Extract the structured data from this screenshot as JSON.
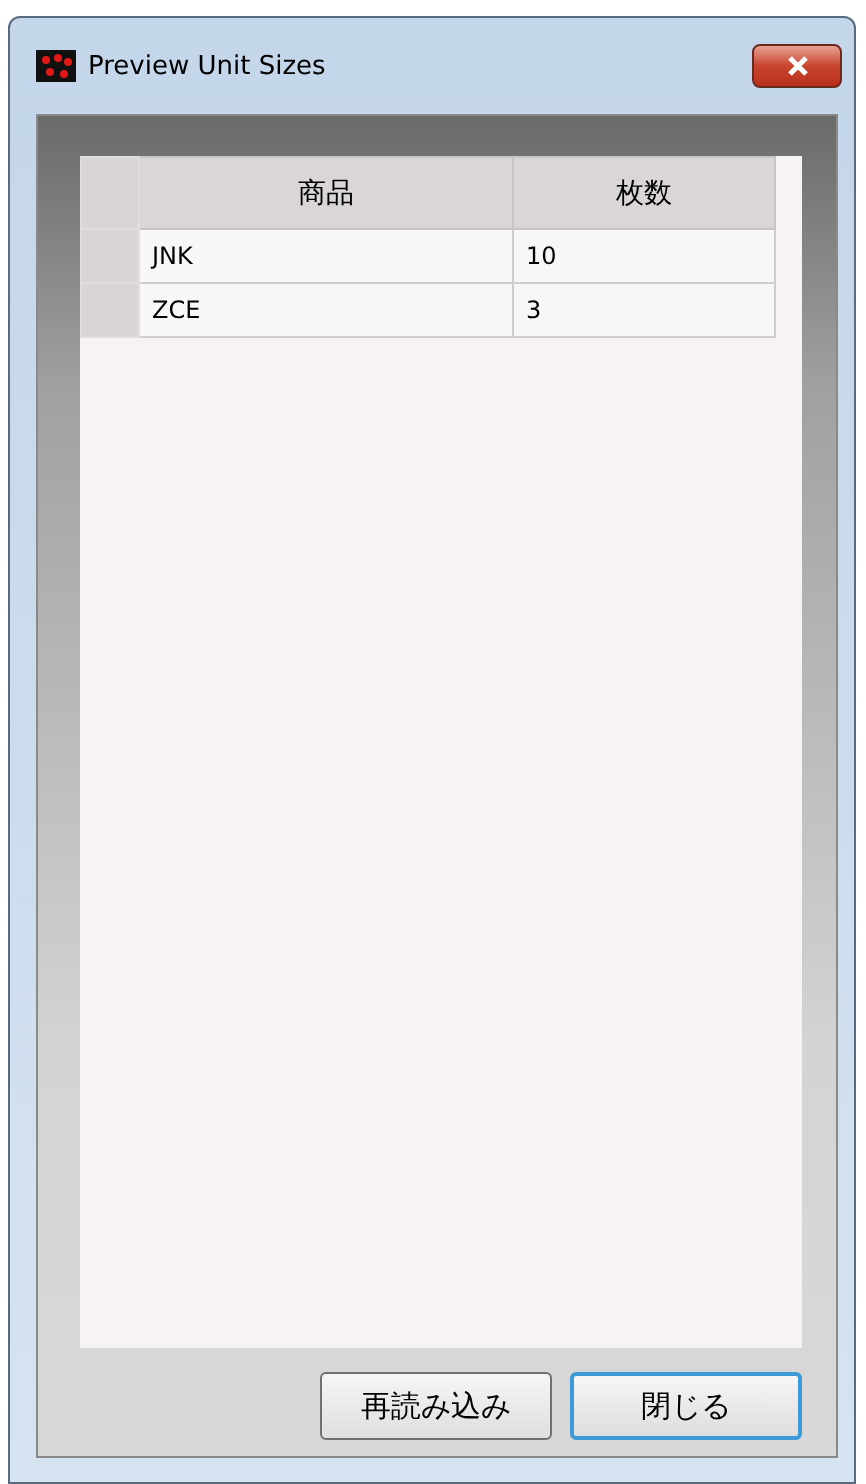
{
  "window": {
    "title": "Preview Unit Sizes"
  },
  "table": {
    "columns": [
      "商品",
      "枚数"
    ],
    "rows": [
      {
        "cells": [
          "JNK",
          "10"
        ]
      },
      {
        "cells": [
          "ZCE",
          "3"
        ]
      }
    ]
  },
  "buttons": [
    {
      "label": "再読み込み",
      "selected": false
    },
    {
      "label": "閉じる",
      "selected": true
    }
  ]
}
